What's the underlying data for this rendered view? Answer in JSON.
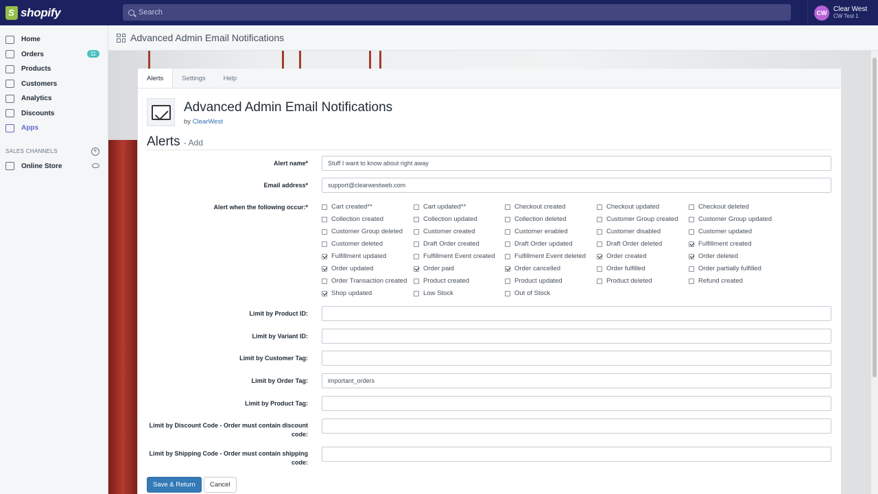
{
  "topbar": {
    "brand": "shopify",
    "search_placeholder": "Search",
    "account_initials": "CW",
    "account_name": "Clear West",
    "account_store": "CW Test 1"
  },
  "sidebar": {
    "items": [
      {
        "label": "Home",
        "icon": "home-icon"
      },
      {
        "label": "Orders",
        "icon": "orders-icon",
        "badge": "11"
      },
      {
        "label": "Products",
        "icon": "tag-icon"
      },
      {
        "label": "Customers",
        "icon": "person-icon"
      },
      {
        "label": "Analytics",
        "icon": "bar-chart-icon"
      },
      {
        "label": "Discounts",
        "icon": "discount-icon"
      },
      {
        "label": "Apps",
        "icon": "apps-icon"
      }
    ],
    "channels_heading": "SALES CHANNELS",
    "online_store": "Online Store"
  },
  "page": {
    "title": "Advanced Admin Email Notifications"
  },
  "tabs": [
    "Alerts",
    "Settings",
    "Help"
  ],
  "app": {
    "name": "Advanced Admin Email Notifications",
    "by": "by",
    "author": "ClearWest"
  },
  "form": {
    "section_title": "Alerts",
    "section_sub": "- Add",
    "alert_name_label": "Alert name*",
    "alert_name_value": "Stuff I want to know about right away",
    "email_label": "Email address*",
    "email_value": "support@clearwestweb.com",
    "events_label": "Alert when the following occur:*",
    "events": [
      {
        "label": "Cart created**",
        "checked": false
      },
      {
        "label": "Cart updated**",
        "checked": false
      },
      {
        "label": "Checkout created",
        "checked": false
      },
      {
        "label": "Checkout updated",
        "checked": false
      },
      {
        "label": "Checkout deleted",
        "checked": false
      },
      {
        "label": "Collection created",
        "checked": false
      },
      {
        "label": "Collection updated",
        "checked": false
      },
      {
        "label": "Collection deleted",
        "checked": false
      },
      {
        "label": "Customer Group created",
        "checked": false
      },
      {
        "label": "Customer Group updated",
        "checked": false
      },
      {
        "label": "Customer Group deleted",
        "checked": false
      },
      {
        "label": "Customer created",
        "checked": false
      },
      {
        "label": "Customer enabled",
        "checked": false
      },
      {
        "label": "Customer disabled",
        "checked": false
      },
      {
        "label": "Customer updated",
        "checked": false
      },
      {
        "label": "Customer deleted",
        "checked": false
      },
      {
        "label": "Draft Order created",
        "checked": false
      },
      {
        "label": "Draft Order updated",
        "checked": false
      },
      {
        "label": "Draft Order deleted",
        "checked": false
      },
      {
        "label": "Fulfillment created",
        "checked": true
      },
      {
        "label": "Fulfillment updated",
        "checked": true
      },
      {
        "label": "Fulfillment Event created",
        "checked": false
      },
      {
        "label": "Fulfillment Event deleted",
        "checked": false
      },
      {
        "label": "Order created",
        "checked": true
      },
      {
        "label": "Order deleted",
        "checked": true
      },
      {
        "label": "Order updated",
        "checked": true
      },
      {
        "label": "Order paid",
        "checked": true
      },
      {
        "label": "Order cancelled",
        "checked": true
      },
      {
        "label": "Order fulfilled",
        "checked": false
      },
      {
        "label": "Order partially fulfilled",
        "checked": false
      },
      {
        "label": "Order Transaction created",
        "checked": false
      },
      {
        "label": "Product created",
        "checked": false
      },
      {
        "label": "Product updated",
        "checked": false
      },
      {
        "label": "Product deleted",
        "checked": false
      },
      {
        "label": "Refund created",
        "checked": false
      },
      {
        "label": "Shop updated",
        "checked": true
      },
      {
        "label": "Low Stock",
        "checked": false
      },
      {
        "label": "Out of Stock",
        "checked": false
      }
    ],
    "limits": [
      {
        "label": "Limit by Product ID:",
        "value": ""
      },
      {
        "label": "Limit by Variant ID:",
        "value": ""
      },
      {
        "label": "Limit by Customer Tag:",
        "value": ""
      },
      {
        "label": "Limit by Order Tag:",
        "value": "important_orders"
      },
      {
        "label": "Limit by Product Tag:",
        "value": ""
      },
      {
        "label": "Limit by Discount Code - Order must contain discount code:",
        "value": ""
      },
      {
        "label": "Limit by Shipping Code - Order must contain shipping code:",
        "value": ""
      }
    ],
    "save_label": "Save & Return",
    "cancel_label": "Cancel"
  }
}
